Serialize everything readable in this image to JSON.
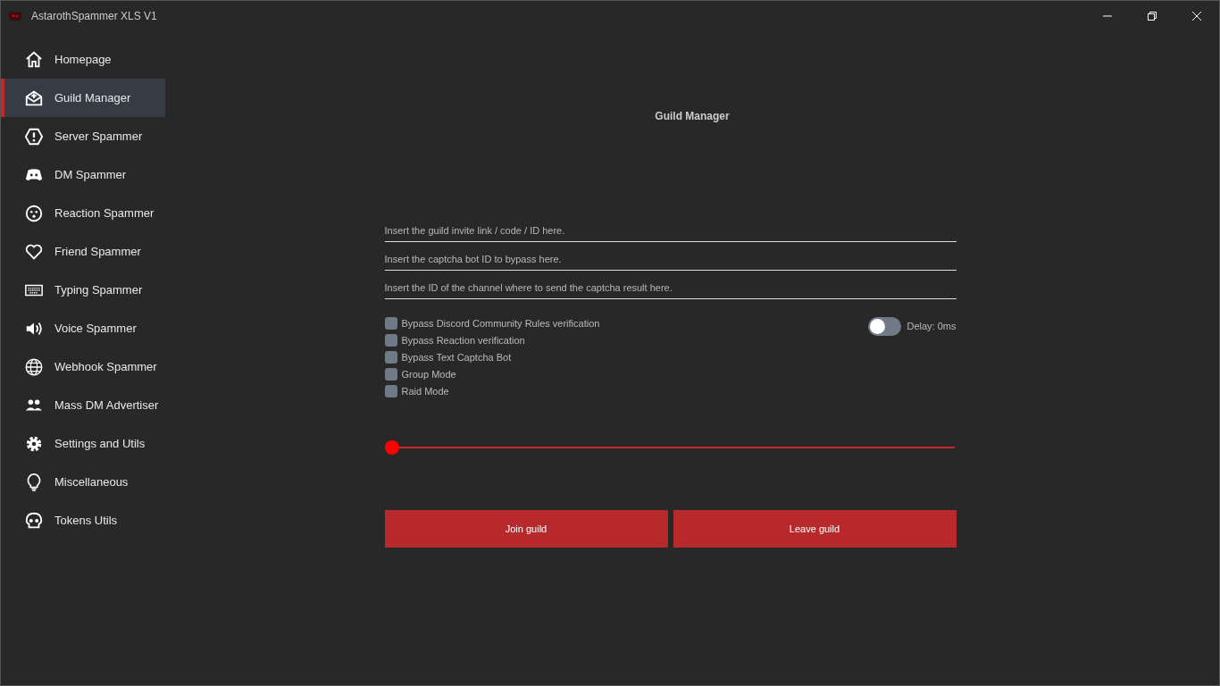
{
  "window": {
    "title": "AstarothSpammer XLS V1"
  },
  "sidebar": {
    "items": [
      {
        "label": "Homepage",
        "selected": false
      },
      {
        "label": "Guild Manager",
        "selected": true
      },
      {
        "label": "Server Spammer",
        "selected": false
      },
      {
        "label": "DM Spammer",
        "selected": false
      },
      {
        "label": "Reaction Spammer",
        "selected": false
      },
      {
        "label": "Friend Spammer",
        "selected": false
      },
      {
        "label": "Typing Spammer",
        "selected": false
      },
      {
        "label": "Voice Spammer",
        "selected": false
      },
      {
        "label": "Webhook Spammer",
        "selected": false
      },
      {
        "label": "Mass DM Advertiser",
        "selected": false
      },
      {
        "label": "Settings and Utils",
        "selected": false
      },
      {
        "label": "Miscellaneous",
        "selected": false
      },
      {
        "label": "Tokens Utils",
        "selected": false
      }
    ]
  },
  "page": {
    "title": "Guild Manager",
    "fields": [
      {
        "placeholder": "Insert the guild invite link / code / ID here."
      },
      {
        "placeholder": "Insert the captcha bot ID to bypass here."
      },
      {
        "placeholder": "Insert the ID of the channel where to send the captcha result here."
      }
    ],
    "checkboxes": [
      {
        "label": "Bypass Discord Community Rules verification",
        "checked": false
      },
      {
        "label": "Bypass Reaction verification",
        "checked": false
      },
      {
        "label": "Bypass Text Captcha Bot",
        "checked": false
      },
      {
        "label": "Group Mode",
        "checked": false
      },
      {
        "label": "Raid Mode",
        "checked": false
      }
    ],
    "delay_toggle": {
      "label": "Delay: 0ms",
      "on": false
    },
    "slider": {
      "level": 0
    },
    "buttons": [
      "Join guild",
      "Leave guild"
    ]
  }
}
